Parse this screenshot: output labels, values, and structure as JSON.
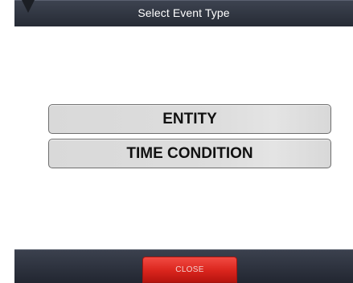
{
  "dialog": {
    "title": "Select Event Type"
  },
  "options": [
    {
      "label": "ENTITY"
    },
    {
      "label": "TIME CONDITION"
    }
  ],
  "footer": {
    "close_label": "CLOSE"
  },
  "colors": {
    "header_bg": "#2f343f",
    "close_button": "#e0302a",
    "option_bg": "#dcdcdc"
  }
}
